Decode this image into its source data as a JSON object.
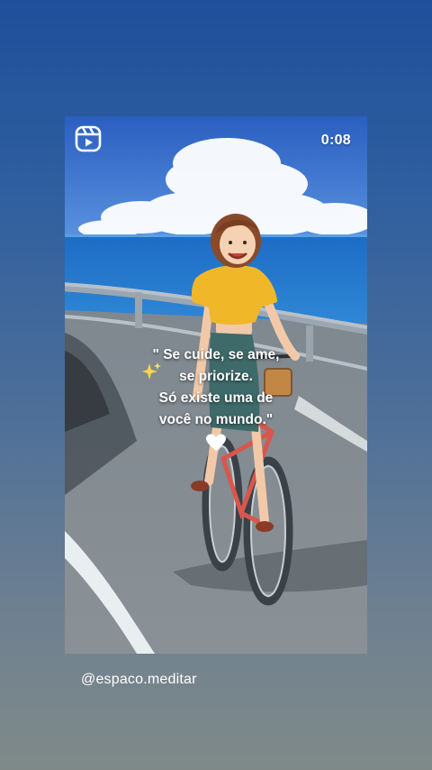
{
  "story": {
    "timer": "0:08",
    "quote_lines": [
      "\" Se cuide, se ame,",
      "se priorize.",
      "Só existe uma de",
      "você no mundo.\""
    ],
    "handle": "@espaco.meditar",
    "icons": {
      "reels": "reels-icon",
      "sparkles": "sparkles-icon",
      "heart": "white-heart-icon"
    }
  },
  "colors": {
    "background_top": "#1f4f9a",
    "background_bottom": "#7f8a88",
    "shirt": "#f0b729",
    "bike": "#d9564a",
    "sea": "#1f6fc0",
    "sky": "#2c63c2"
  }
}
